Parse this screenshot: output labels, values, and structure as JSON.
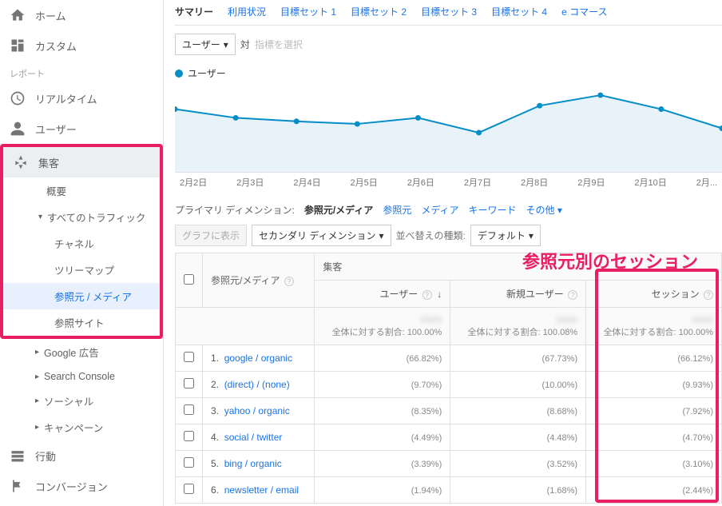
{
  "sidebar": {
    "home": "ホーム",
    "custom": "カスタム",
    "reports_label": "レポート",
    "realtime": "リアルタイム",
    "user": "ユーザー",
    "acquisition": "集客",
    "overview": "概要",
    "all_traffic": "すべてのトラフィック",
    "channels": "チャネル",
    "treemap": "ツリーマップ",
    "source_media": "参照元 / メディア",
    "referral": "参照サイト",
    "google_ads": "Google 広告",
    "search_console": "Search Console",
    "social": "ソーシャル",
    "campaign": "キャンペーン",
    "behavior": "行動",
    "conversion": "コンバージョン"
  },
  "tabs": [
    "サマリー",
    "利用状況",
    "目標セット 1",
    "目標セット 2",
    "目標セット 3",
    "目標セット 4",
    "e コマース"
  ],
  "toolbar": {
    "user_combo": "ユーザー",
    "vs": "対",
    "metric_placeholder": "指標を選択"
  },
  "legend": {
    "user": "ユーザー"
  },
  "chart_data": {
    "type": "line",
    "categories": [
      "2月2日",
      "2月3日",
      "2月4日",
      "2月5日",
      "2月6日",
      "2月7日",
      "2月8日",
      "2月9日",
      "2月10日",
      "2月..."
    ],
    "values": [
      72,
      62,
      58,
      55,
      62,
      45,
      76,
      88,
      72,
      50
    ],
    "ylim": [
      0,
      100
    ],
    "series_name": "ユーザー"
  },
  "dimension_row": {
    "label": "プライマリ ディメンション:",
    "active": "参照元/メディア",
    "others": [
      "参照元",
      "メディア",
      "キーワード",
      "その他"
    ]
  },
  "controls": {
    "plot_btn": "グラフに表示",
    "secondary_dim": "セカンダリ ディメンション",
    "sort_label": "並べ替えの種類:",
    "sort_value": "デフォルト"
  },
  "overlay_label": "参照元別のセッション",
  "table": {
    "header": {
      "source_media": "参照元/メディア",
      "acquisition": "集客",
      "user": "ユーザー",
      "new_user": "新規ユーザー",
      "session": "セッション"
    },
    "totals": {
      "label": "全体に対する割合:",
      "user": "100.00%",
      "new_user": "100.08%",
      "session": "100.00%"
    },
    "rows": [
      {
        "n": "1.",
        "src": "google / organic",
        "u": "(66.82%)",
        "nu": "(67.73%)",
        "s": "(66.12%)"
      },
      {
        "n": "2.",
        "src": "(direct) / (none)",
        "u": "(9.70%)",
        "nu": "(10.00%)",
        "s": "(9.93%)"
      },
      {
        "n": "3.",
        "src": "yahoo / organic",
        "u": "(8.35%)",
        "nu": "(8.68%)",
        "s": "(7.92%)"
      },
      {
        "n": "4.",
        "src": "social / twitter",
        "u": "(4.49%)",
        "nu": "(4.48%)",
        "s": "(4.70%)"
      },
      {
        "n": "5.",
        "src": "bing / organic",
        "u": "(3.39%)",
        "nu": "(3.52%)",
        "s": "(3.10%)"
      },
      {
        "n": "6.",
        "src": "newsletter / email",
        "u": "(1.94%)",
        "nu": "(1.68%)",
        "s": "(2.44%)"
      }
    ]
  }
}
